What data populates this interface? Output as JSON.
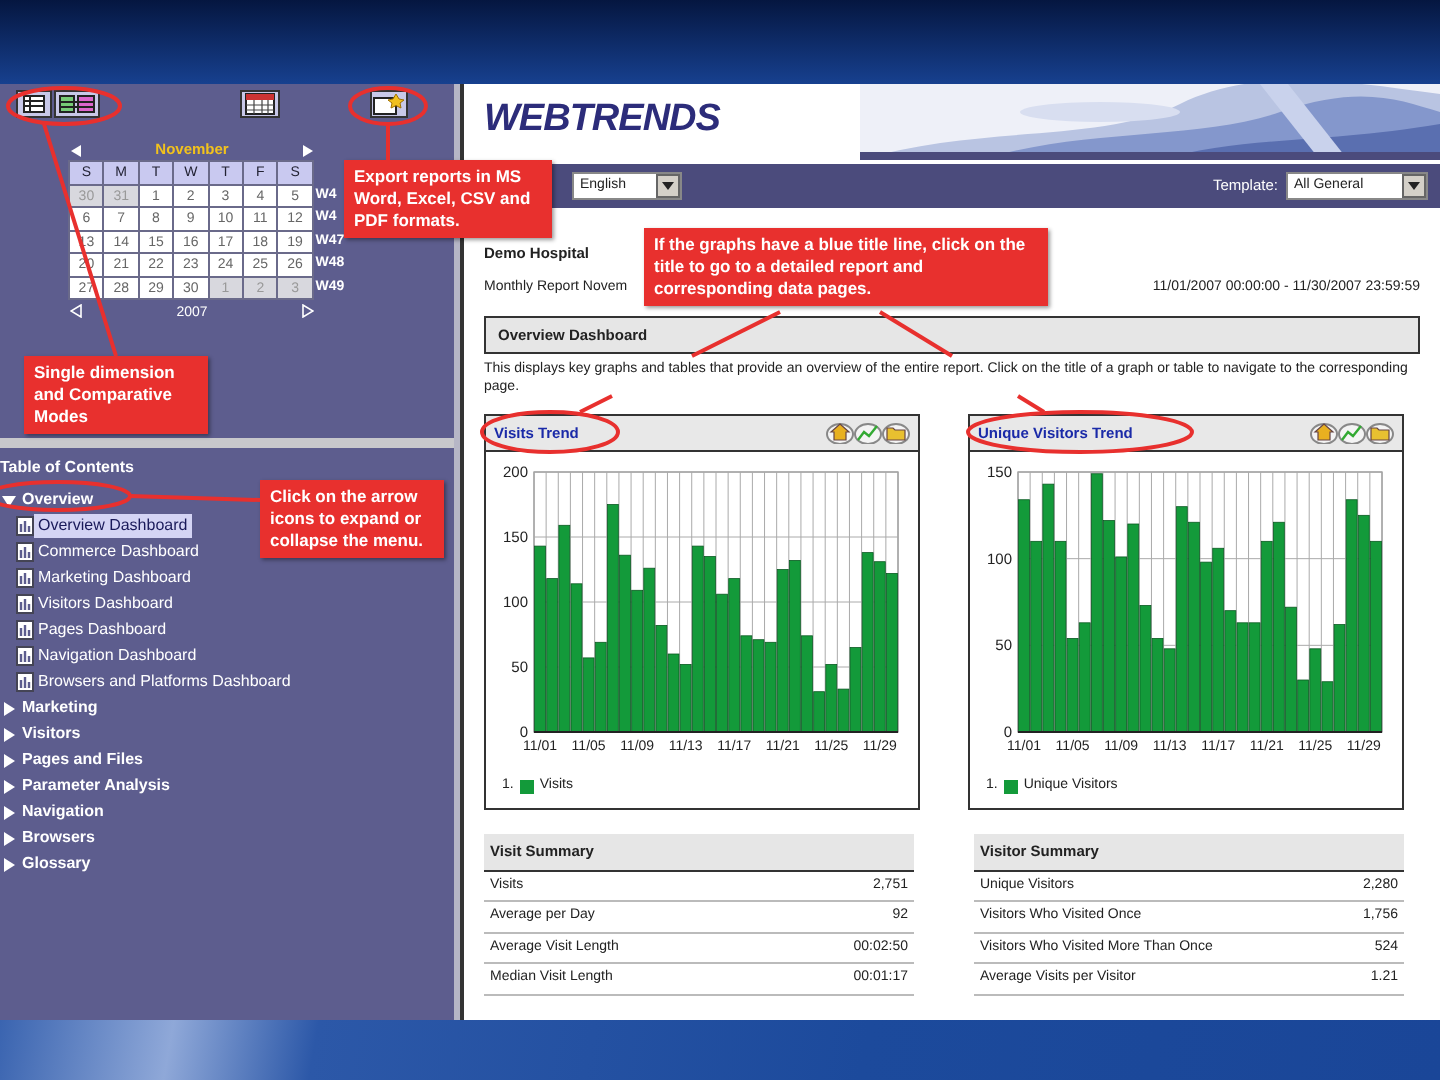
{
  "calendar": {
    "month": "November",
    "year": "2007",
    "weekdays": [
      "S",
      "M",
      "T",
      "W",
      "T",
      "F",
      "S"
    ],
    "weeks": [
      {
        "label": "W4",
        "days": [
          {
            "d": "30",
            "other_month": true
          },
          {
            "d": "31",
            "other_month": true
          },
          {
            "d": "1",
            "other_month": false
          },
          {
            "d": "2",
            "other_month": false
          },
          {
            "d": "3",
            "other_month": false
          },
          {
            "d": "4",
            "other_month": false
          },
          {
            "d": "5",
            "other_month": false
          }
        ]
      },
      {
        "label": "W4",
        "days": [
          {
            "d": "6",
            "other_month": false
          },
          {
            "d": "7",
            "other_month": false
          },
          {
            "d": "8",
            "other_month": false
          },
          {
            "d": "9",
            "other_month": false
          },
          {
            "d": "10",
            "other_month": false
          },
          {
            "d": "11",
            "other_month": false
          },
          {
            "d": "12",
            "other_month": false
          }
        ]
      },
      {
        "label": "W47",
        "days": [
          {
            "d": "13",
            "other_month": false
          },
          {
            "d": "14",
            "other_month": false
          },
          {
            "d": "15",
            "other_month": false
          },
          {
            "d": "16",
            "other_month": false
          },
          {
            "d": "17",
            "other_month": false
          },
          {
            "d": "18",
            "other_month": false
          },
          {
            "d": "19",
            "other_month": false
          }
        ]
      },
      {
        "label": "W48",
        "days": [
          {
            "d": "20",
            "other_month": false
          },
          {
            "d": "21",
            "other_month": false
          },
          {
            "d": "22",
            "other_month": false
          },
          {
            "d": "23",
            "other_month": false
          },
          {
            "d": "24",
            "other_month": false
          },
          {
            "d": "25",
            "other_month": false
          },
          {
            "d": "26",
            "other_month": false
          }
        ]
      },
      {
        "label": "W49",
        "days": [
          {
            "d": "27",
            "other_month": false
          },
          {
            "d": "28",
            "other_month": false
          },
          {
            "d": "29",
            "other_month": false
          },
          {
            "d": "30",
            "other_month": false
          },
          {
            "d": "1",
            "other_month": true
          },
          {
            "d": "2",
            "other_month": true
          },
          {
            "d": "3",
            "other_month": true
          }
        ]
      }
    ]
  },
  "toc": {
    "title": "Table of Contents",
    "items": [
      {
        "label": "Overview",
        "expanded": true,
        "children": [
          {
            "label": "Overview Dashboard",
            "selected": true
          },
          {
            "label": "Commerce Dashboard",
            "selected": false
          },
          {
            "label": "Marketing Dashboard",
            "selected": false
          },
          {
            "label": "Visitors Dashboard",
            "selected": false
          },
          {
            "label": "Pages Dashboard",
            "selected": false
          },
          {
            "label": "Navigation Dashboard",
            "selected": false
          },
          {
            "label": "Browsers and Platforms Dashboard",
            "selected": false
          }
        ]
      },
      {
        "label": "Marketing",
        "expanded": false
      },
      {
        "label": "Visitors",
        "expanded": false
      },
      {
        "label": "Pages and Files",
        "expanded": false
      },
      {
        "label": "Parameter Analysis",
        "expanded": false
      },
      {
        "label": "Navigation",
        "expanded": false
      },
      {
        "label": "Browsers",
        "expanded": false
      },
      {
        "label": "Glossary",
        "expanded": false
      }
    ]
  },
  "header": {
    "logo": "WEBTRENDS",
    "language": "English",
    "template_label": "Template:",
    "template": "All General"
  },
  "report": {
    "site": "Demo Hospital",
    "name": "Monthly Report Novem",
    "range": "11/01/2007 00:00:00 - 11/30/2007 23:59:59",
    "section": "Overview Dashboard",
    "description": "This displays key graphs and tables that provide an overview of the entire report. Click on the title of a graph or table to navigate to the corresponding page."
  },
  "graphs": [
    {
      "title": "Visits Trend",
      "legend_index": "1.",
      "chart_data": {
        "type": "bar",
        "categories": [
          "11/01",
          null,
          null,
          null,
          "11/05",
          null,
          null,
          null,
          "11/09",
          null,
          null,
          null,
          "11/13",
          null,
          null,
          null,
          "11/17",
          null,
          null,
          null,
          "11/21",
          null,
          null,
          null,
          "11/25",
          null,
          null,
          null,
          "11/29",
          null
        ],
        "series": [
          {
            "name": "Visits",
            "color": "#139a3a",
            "values": [
              143,
              118,
              159,
              114,
              57,
              69,
              175,
              136,
              109,
              126,
              82,
              60,
              52,
              143,
              135,
              106,
              118,
              74,
              71,
              69,
              125,
              132,
              74,
              31,
              52,
              33,
              65,
              138,
              131,
              122
            ]
          }
        ],
        "ylim": [
          0,
          200
        ],
        "yticks": [
          0,
          50,
          100,
          150,
          200
        ],
        "grid": true
      }
    },
    {
      "title": "Unique Visitors Trend",
      "legend_index": "1.",
      "chart_data": {
        "type": "bar",
        "categories": [
          "11/01",
          null,
          null,
          null,
          "11/05",
          null,
          null,
          null,
          "11/09",
          null,
          null,
          null,
          "11/13",
          null,
          null,
          null,
          "11/17",
          null,
          null,
          null,
          "11/21",
          null,
          null,
          null,
          "11/25",
          null,
          null,
          null,
          "11/29",
          null
        ],
        "series": [
          {
            "name": "Unique Visitors",
            "color": "#139a3a",
            "values": [
              134,
              110,
              143,
              110,
              54,
              63,
              149,
              122,
              101,
              120,
              73,
              54,
              48,
              130,
              121,
              98,
              106,
              70,
              63,
              63,
              110,
              121,
              72,
              30,
              48,
              29,
              62,
              134,
              125,
              110
            ]
          }
        ],
        "ylim": [
          0,
          150
        ],
        "yticks": [
          0,
          50,
          100,
          150
        ],
        "grid": true
      }
    }
  ],
  "summaries": [
    {
      "title": "Visit Summary",
      "rows": [
        {
          "label": "Visits",
          "value": "2,751"
        },
        {
          "label": "Average per Day",
          "value": "92"
        },
        {
          "label": "Average Visit Length",
          "value": "00:02:50"
        },
        {
          "label": "Median Visit Length",
          "value": "00:01:17"
        }
      ]
    },
    {
      "title": "Visitor Summary",
      "rows": [
        {
          "label": "Unique Visitors",
          "value": "2,280"
        },
        {
          "label": "Visitors Who Visited Once",
          "value": "1,756"
        },
        {
          "label": "Visitors Who Visited More Than Once",
          "value": "524"
        },
        {
          "label": "Average Visits per Visitor",
          "value": "1.21"
        }
      ]
    }
  ],
  "callouts": [
    {
      "text": "Export reports in MS Word, Excel, CSV and PDF formats."
    },
    {
      "text": "If the graphs have a blue title line, click on the title to go to a detailed report and corresponding data pages."
    },
    {
      "text": "Single dimension and Comparative Modes"
    },
    {
      "text": "Click on the arrow icons to expand or collapse the menu."
    }
  ]
}
